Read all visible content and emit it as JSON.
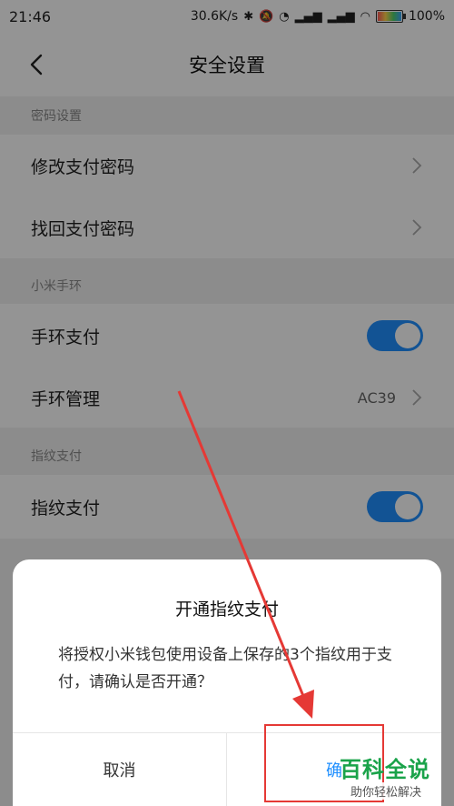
{
  "status_bar": {
    "time": "21:46",
    "network_speed": "30.6K/s",
    "battery": "100%"
  },
  "nav": {
    "title": "安全设置"
  },
  "sections": [
    {
      "header": "密码设置",
      "rows": [
        {
          "label": "修改支付密码"
        },
        {
          "label": "找回支付密码"
        }
      ]
    },
    {
      "header": "小米手环",
      "rows": [
        {
          "label": "手环支付",
          "toggle": true
        },
        {
          "label": "手环管理",
          "value": "AC39"
        }
      ]
    },
    {
      "header": "指纹支付",
      "rows": [
        {
          "label": "指纹支付",
          "toggle": true
        }
      ]
    }
  ],
  "dialog": {
    "title": "开通指纹支付",
    "message": "将授权小米钱包使用设备上保存的3个指纹用于支付，请确认是否开通？",
    "cancel_label": "取消",
    "confirm_label": "确"
  },
  "watermark": {
    "main": "百科全说",
    "sub": "助你轻松解决"
  },
  "colors": {
    "accent": "#1f8fff",
    "annotation": "#e53935",
    "watermark": "#1aa34a"
  }
}
